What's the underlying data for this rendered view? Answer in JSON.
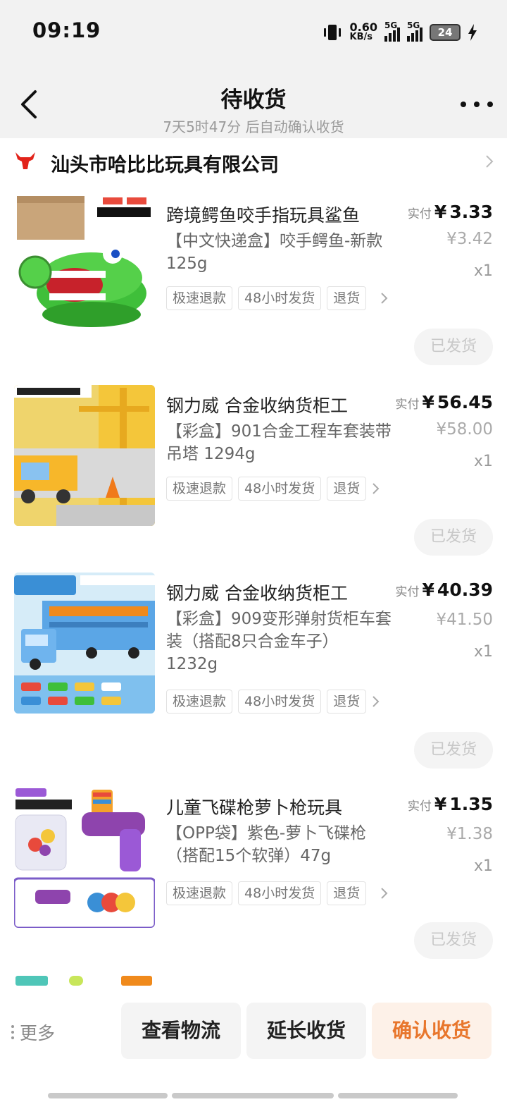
{
  "status_bar": {
    "time": "09:19",
    "speed_value": "0.60",
    "speed_unit": "KB/s",
    "sig1": "5G",
    "sig2": "5G",
    "battery": "24"
  },
  "nav": {
    "title": "待收货",
    "subtitle": "7天5时47分 后自动确认收货"
  },
  "shop": {
    "name": "汕头市哈比比玩具有限公司"
  },
  "items": [
    {
      "title": "跨境鳄鱼咬手指玩具鲨鱼",
      "spec": "【中文快递盒】咬手鳄鱼-新款 125g",
      "paid_label": "实付",
      "currency": "¥",
      "paid": "3.33",
      "original": "¥3.42",
      "qty": "x1",
      "tags": [
        "极速退款",
        "48小时发货",
        "退货"
      ],
      "status": "已发货"
    },
    {
      "title": "钢力威 合金收纳货柜工",
      "spec": "【彩盒】901合金工程车套装带吊塔 1294g",
      "paid_label": "实付",
      "currency": "¥",
      "paid": "56.45",
      "original": "¥58.00",
      "qty": "x1",
      "tags": [
        "极速退款",
        "48小时发货",
        "退货"
      ],
      "status": "已发货"
    },
    {
      "title": "钢力威 合金收纳货柜工",
      "spec": "【彩盒】909变形弹射货柜车套装（搭配8只合金车子） 1232g",
      "paid_label": "实付",
      "currency": "¥",
      "paid": "40.39",
      "original": "¥41.50",
      "qty": "x1",
      "tags": [
        "极速退款",
        "48小时发货",
        "退货"
      ],
      "status": "已发货"
    },
    {
      "title": "儿童飞碟枪萝卜枪玩具",
      "spec": "【OPP袋】紫色-萝卜飞碟枪（搭配15个软弹）47g",
      "paid_label": "实付",
      "currency": "¥",
      "paid": "1.35",
      "original": "¥1.38",
      "qty": "x1",
      "tags": [
        "极速退款",
        "48小时发货",
        "退货"
      ],
      "status": "已发货"
    }
  ],
  "bottom": {
    "more": "更多",
    "logistics": "查看物流",
    "extend": "延长收货",
    "confirm": "确认收货"
  },
  "colors": {
    "accent": "#e8762c",
    "shop_logo": "#e2231a"
  },
  "icons": [
    "vibrate-icon",
    "signal-icon",
    "battery-icon",
    "bolt-icon",
    "back-arrow-icon",
    "more-dots-icon",
    "bull-logo-icon",
    "chevron-right-icon"
  ]
}
